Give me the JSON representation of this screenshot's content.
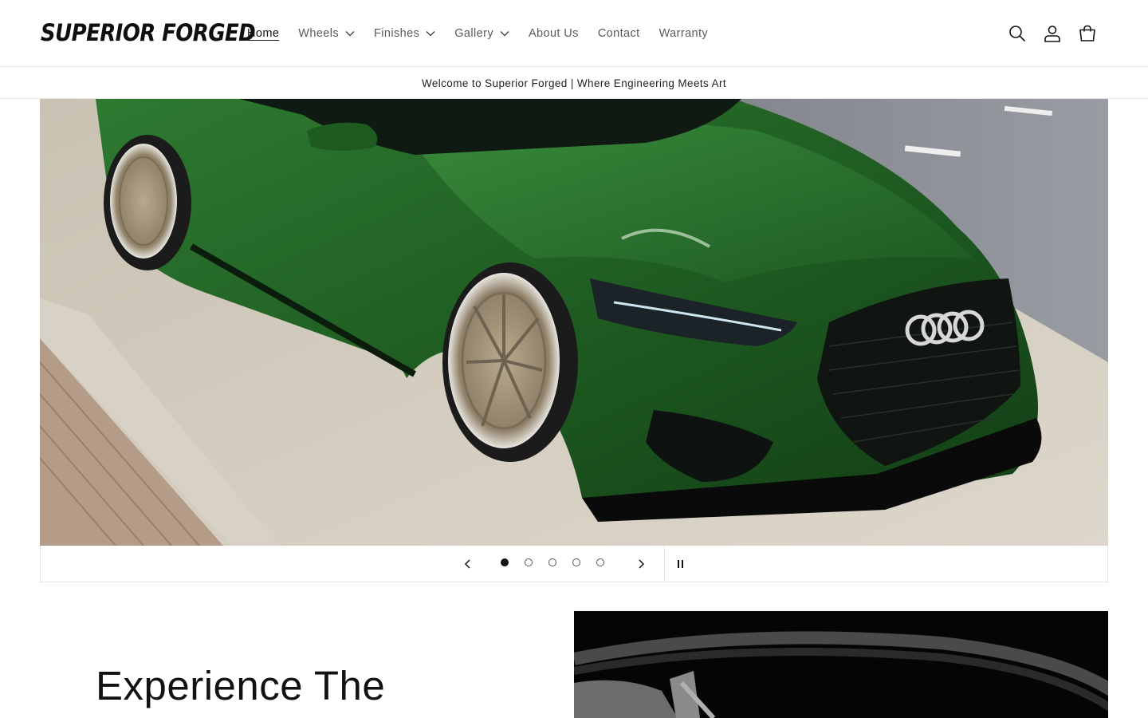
{
  "brand": {
    "logo_text": "SUPERIOR FORGED"
  },
  "nav": {
    "items": [
      {
        "label": "Home",
        "active": true,
        "has_dropdown": false
      },
      {
        "label": "Wheels",
        "active": false,
        "has_dropdown": true
      },
      {
        "label": "Finishes",
        "active": false,
        "has_dropdown": true
      },
      {
        "label": "Gallery",
        "active": false,
        "has_dropdown": true
      },
      {
        "label": "About Us",
        "active": false,
        "has_dropdown": false
      },
      {
        "label": "Contact",
        "active": false,
        "has_dropdown": false
      },
      {
        "label": "Warranty",
        "active": false,
        "has_dropdown": false
      }
    ]
  },
  "header_icons": [
    "search-icon",
    "account-icon",
    "cart-icon"
  ],
  "announcement": {
    "text": "Welcome to Superior Forged | Where Engineering Meets Art"
  },
  "slideshow": {
    "slide_count": 5,
    "current_slide": 1,
    "playing": true
  },
  "feature": {
    "heading": "Experience The"
  },
  "colors": {
    "text": "#121212",
    "muted": "#5a5a5a",
    "border": "#e6e6e6",
    "car_green": "#1f5a23"
  }
}
